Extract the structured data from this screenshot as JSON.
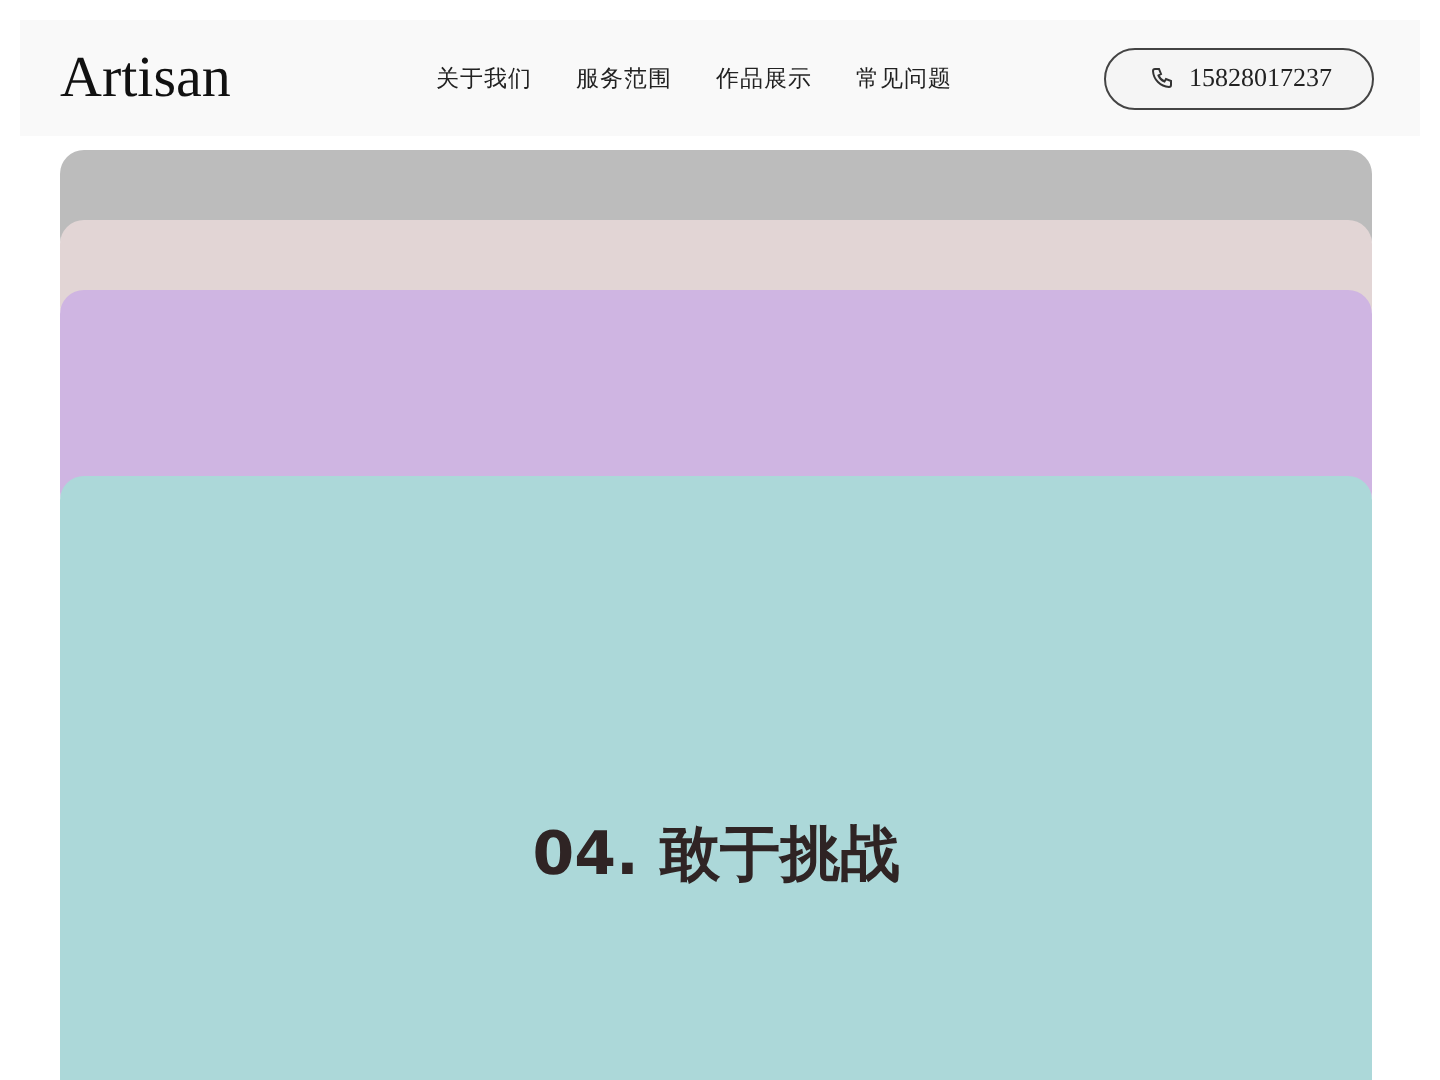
{
  "header": {
    "logo": "Artisan",
    "nav": [
      {
        "label": "关于我们"
      },
      {
        "label": "服务范围"
      },
      {
        "label": "作品展示"
      },
      {
        "label": "常见问题"
      }
    ],
    "phone": "15828017237"
  },
  "cards": [
    {
      "color": "#bcbcbc"
    },
    {
      "color": "#e2d5d5"
    },
    {
      "color": "#cfb5e2"
    },
    {
      "color": "#acd8d9",
      "title": "04. 敢于挑战"
    }
  ]
}
